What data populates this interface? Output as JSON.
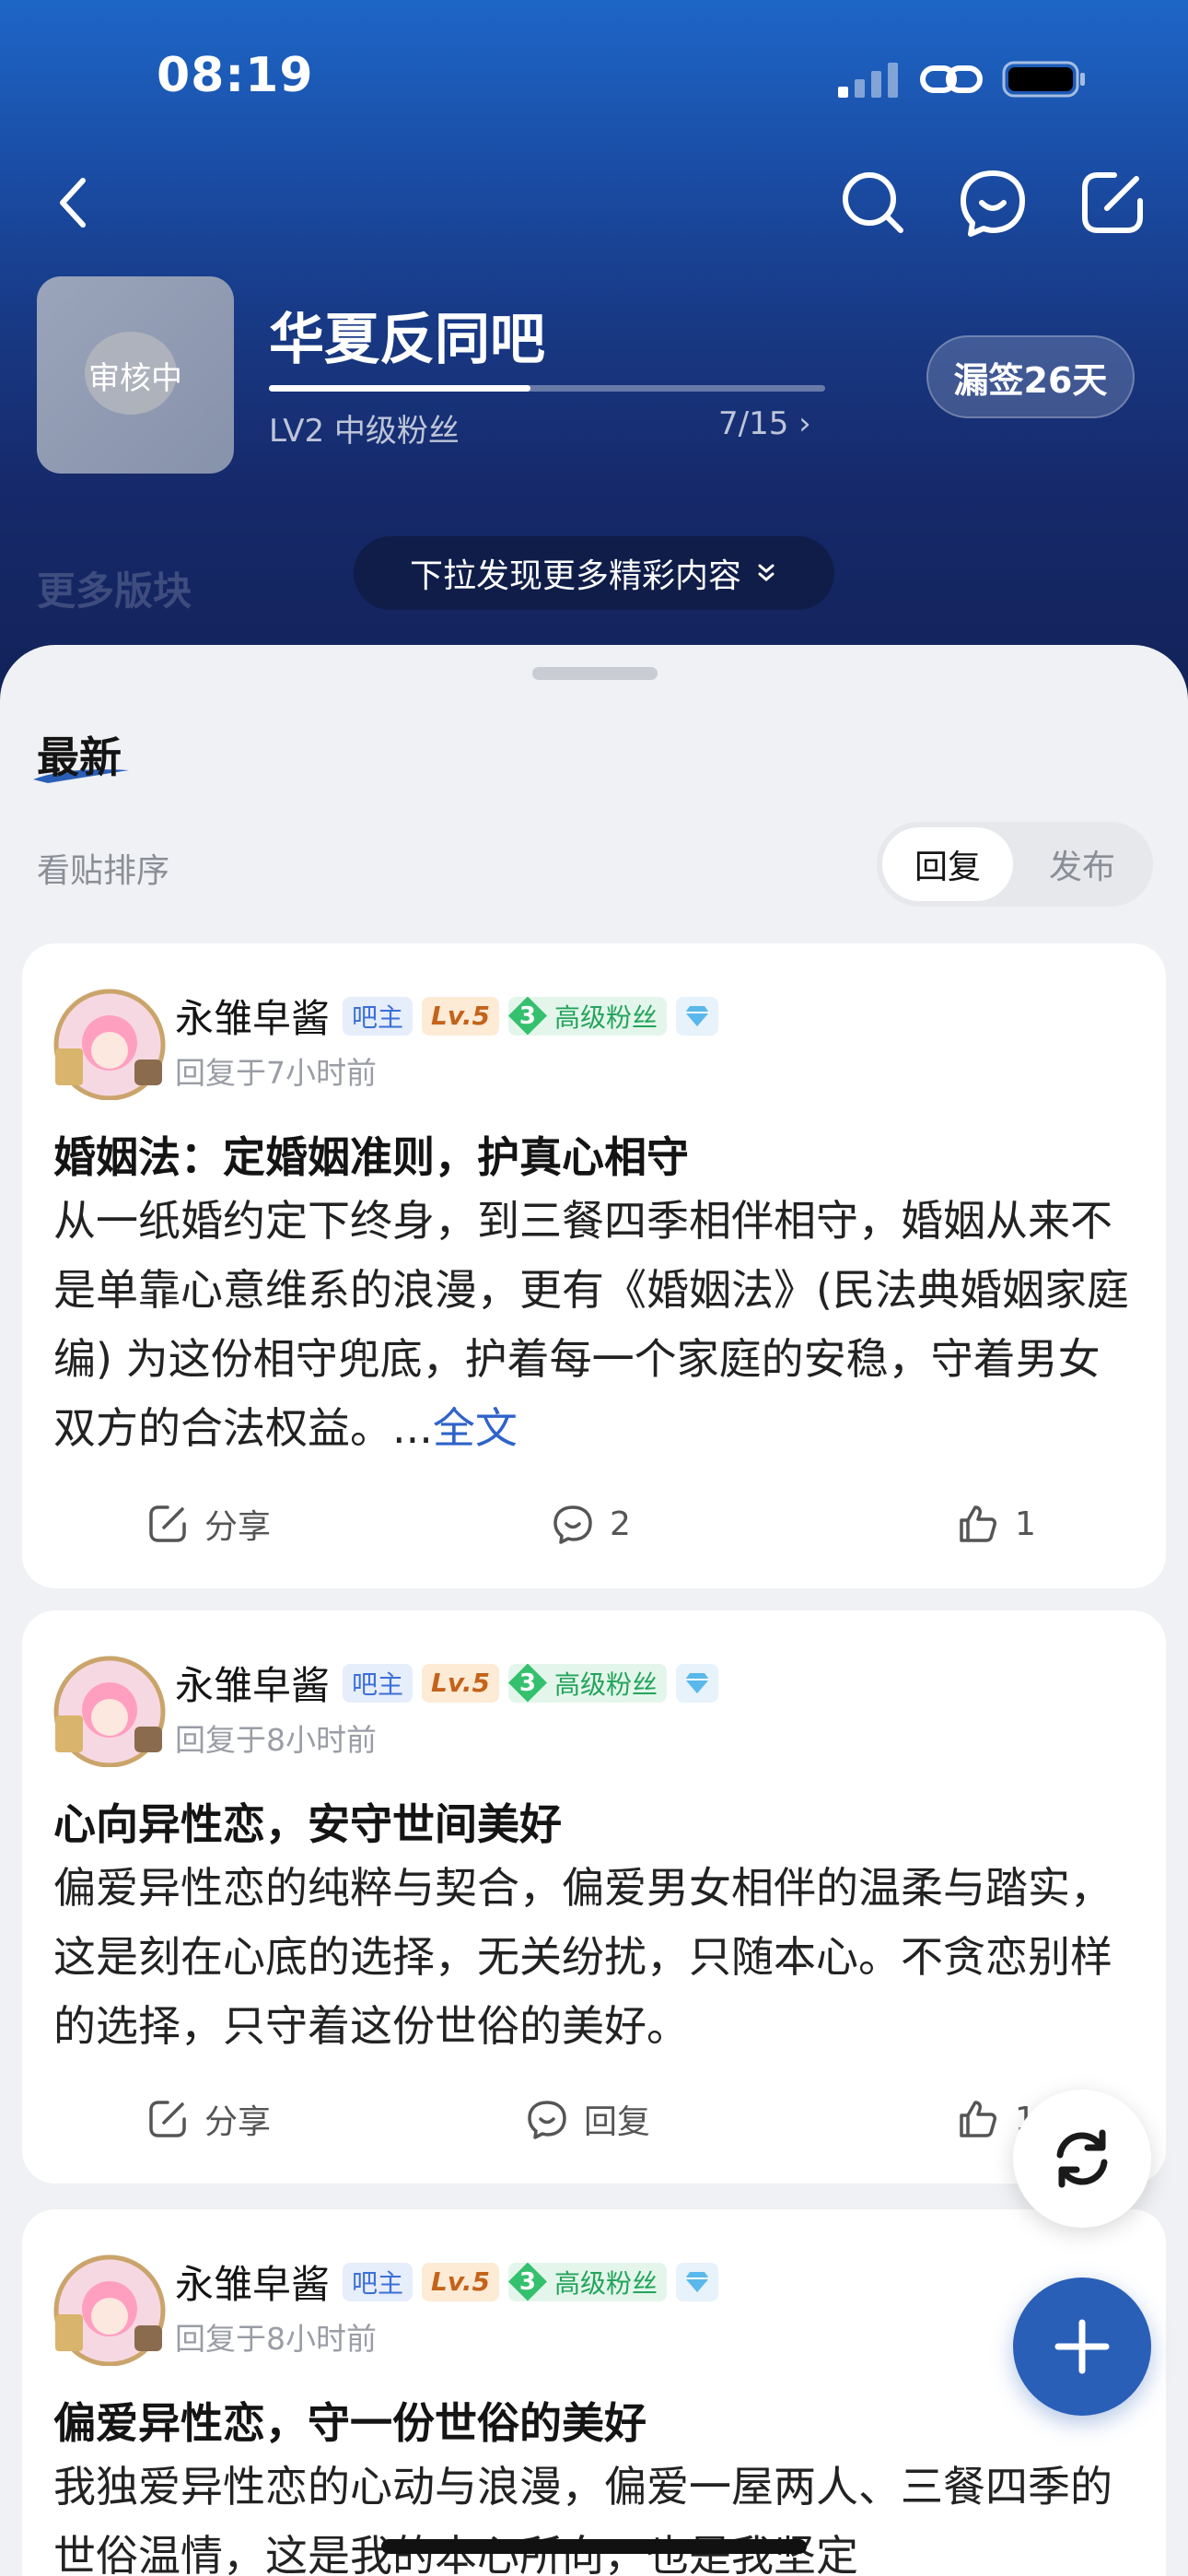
{
  "status_bar": {
    "time": "08:19"
  },
  "forum": {
    "name": "华夏反同吧",
    "avatar_status": "审核中",
    "level_label": "LV2 中级粉丝",
    "level_progress": "7/15",
    "level_fraction": 0.47,
    "signin_label": "漏签26天",
    "more_sections": "更多版块",
    "pull_hint": "下拉发现更多精彩内容"
  },
  "feed": {
    "section_title": "最新",
    "sort_label": "看贴排序",
    "sort_options": {
      "active": "回复",
      "inactive": "发布"
    }
  },
  "posts": [
    {
      "author": "永雏皁酱",
      "badge_owner": "吧主",
      "badge_level": "Lv.5",
      "fan_level": "3",
      "fan_title": "高级粉丝",
      "time": "回复于7小时前",
      "title": "婚姻法：定婚姻准则，护真心相守",
      "body": "从一纸婚约定下终身，到三餐四季相伴相守，婚姻从来不是单靠心意维系的浪漫，更有《婚姻法》(民法典婚姻家庭编) 为这份相守兜底，护着每一个家庭的安稳，守着男女双方的合法权益。...",
      "more_link": "全文",
      "share_label": "分享",
      "comment_label": "2",
      "like_label": "1"
    },
    {
      "author": "永雏皁酱",
      "badge_owner": "吧主",
      "badge_level": "Lv.5",
      "fan_level": "3",
      "fan_title": "高级粉丝",
      "time": "回复于8小时前",
      "title": "心向异性恋，安守世间美好",
      "body": "偏爱异性恋的纯粹与契合，偏爱男女相伴的温柔与踏实，这是刻在心底的选择，无关纷扰，只随本心。不贪恋别样的选择，只守着这份世俗的美好。",
      "share_label": "分享",
      "comment_label": "回复",
      "like_label": "1"
    },
    {
      "author": "永雏皁酱",
      "badge_owner": "吧主",
      "badge_level": "Lv.5",
      "fan_level": "3",
      "fan_title": "高级粉丝",
      "time": "回复于8小时前",
      "title": "偏爱异性恋，守一份世俗的美好",
      "body": "我独爱异性恋的心动与浪漫，偏爱一屋两人、三餐四季的世俗温情，这是我的本心所向，也是我坚定"
    }
  ],
  "colors": {
    "accent": "#2a5fb8",
    "link": "#2f63c9",
    "header_top": "#1e66c7",
    "header_bottom": "#122259"
  },
  "icons": [
    "back-icon",
    "search-icon",
    "message-icon",
    "edit-icon",
    "share-icon",
    "comment-icon",
    "like-icon",
    "refresh-icon",
    "plus-icon"
  ]
}
